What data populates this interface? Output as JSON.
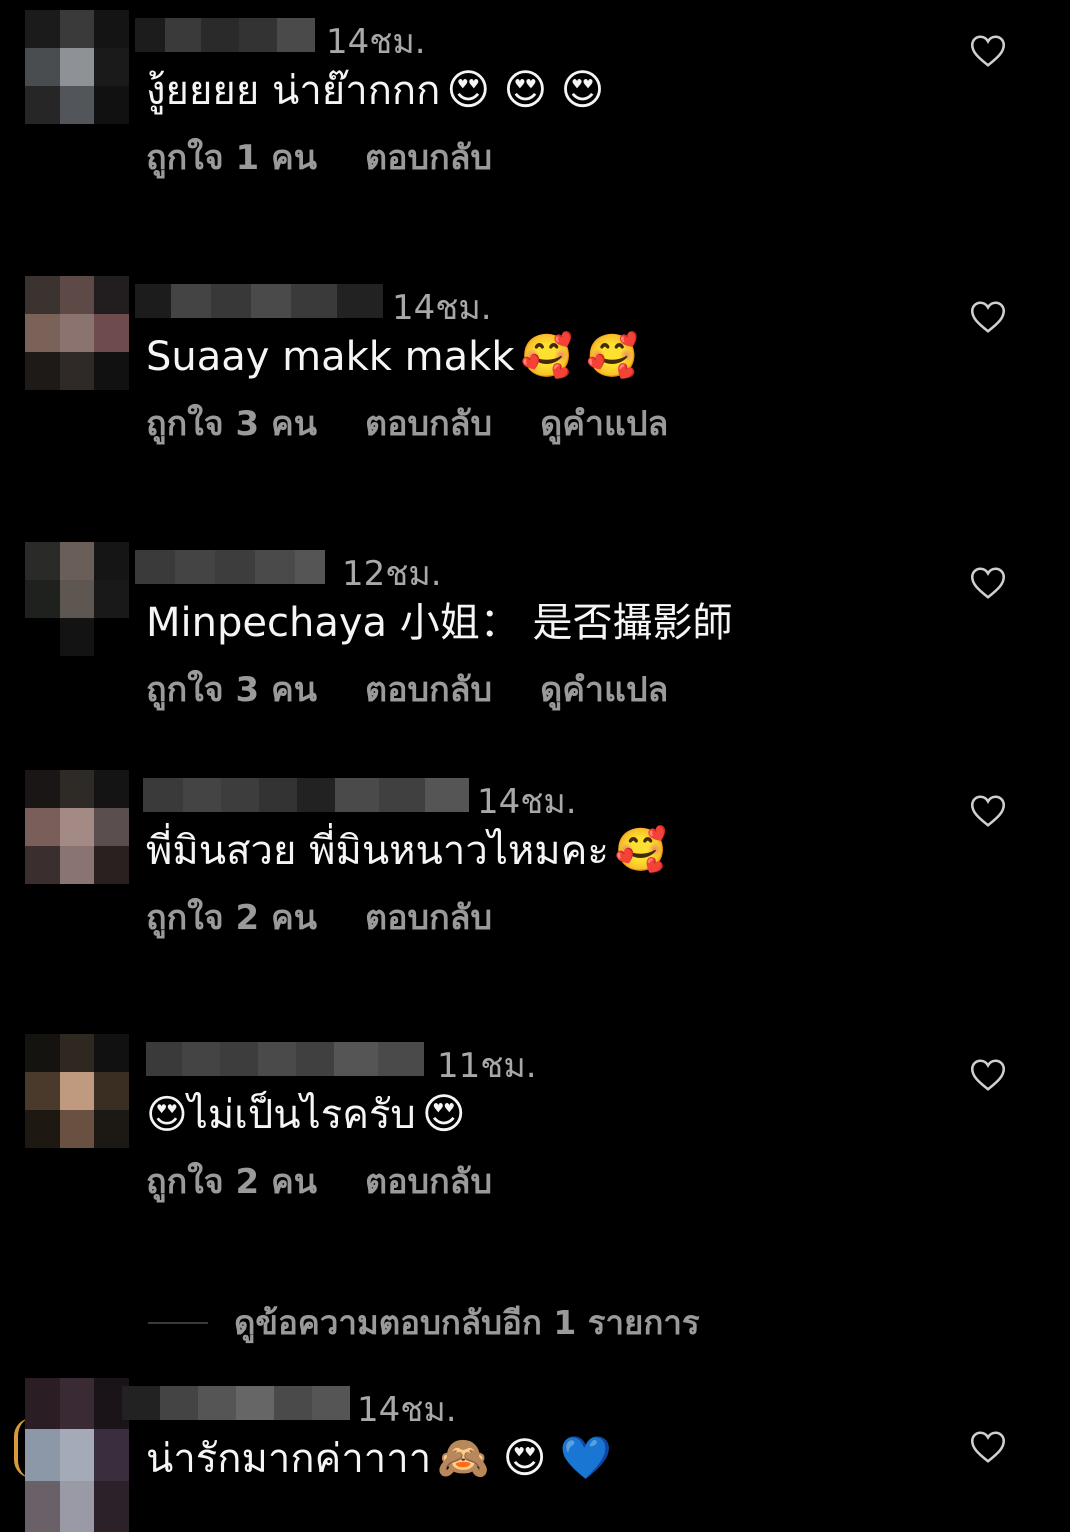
{
  "comments": [
    {
      "time": "14ชม.",
      "text": "งู้ยยยย น่าย๊ากกก",
      "emoji": "😍 😍 😍",
      "likes": "ถูกใจ 1 คน",
      "reply": "ตอบกลับ",
      "translate": ""
    },
    {
      "time": "14ชม.",
      "text": "Suaay makk makk",
      "emoji": "🥰 🥰",
      "likes": "ถูกใจ 3 คน",
      "reply": "ตอบกลับ",
      "translate": "ดูคำแปล"
    },
    {
      "time": "12ชม.",
      "text": "Minpechaya 小姐： 是否攝影師",
      "emoji": "",
      "likes": "ถูกใจ 3 คน",
      "reply": "ตอบกลับ",
      "translate": "ดูคำแปล"
    },
    {
      "time": "14ชม.",
      "text": "พี่มินสวย พี่มินหนาวไหมคะ",
      "emoji": "🥰",
      "likes": "ถูกใจ 2 คน",
      "reply": "ตอบกลับ",
      "translate": ""
    },
    {
      "time": "11ชม.",
      "text": "😍ไม่เป็นไรครับ",
      "emoji": "😍",
      "likes": "ถูกใจ 2 คน",
      "reply": "ตอบกลับ",
      "translate": ""
    },
    {
      "time": "14ชม.",
      "text": "น่ารักมากค่าาาา",
      "emoji": "🙈 😍 💙",
      "likes": "",
      "reply": "",
      "translate": ""
    }
  ],
  "more_replies": "ดูข้อความตอบกลับอีก 1 รายการ",
  "icons": {
    "like": "heart-outline-icon"
  },
  "colors": {
    "background": "#000000",
    "text": "#f5f5f5",
    "secondary": "#9a9a9a",
    "story_ring": "#d89a3a"
  }
}
